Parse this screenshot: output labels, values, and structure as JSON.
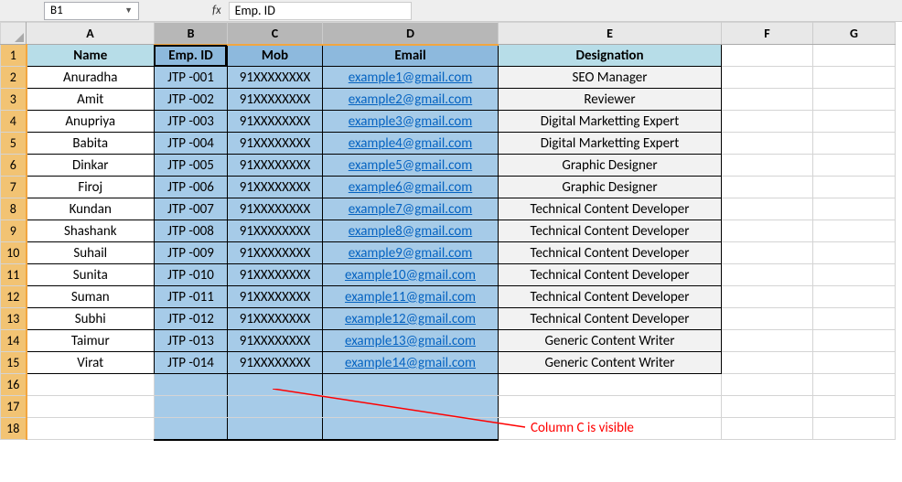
{
  "namebox": {
    "ref": "B1"
  },
  "formula_bar": {
    "fx": "fx",
    "value": "Emp. ID"
  },
  "col_letters": [
    "A",
    "B",
    "C",
    "D",
    "E",
    "F",
    "G"
  ],
  "row_numbers": [
    "1",
    "2",
    "3",
    "4",
    "5",
    "6",
    "7",
    "8",
    "9",
    "10",
    "11",
    "12",
    "13",
    "14",
    "15",
    "16",
    "17",
    "18"
  ],
  "headers": {
    "name": "Name",
    "emp": "Emp. ID",
    "mob": "Mob",
    "email": "Email",
    "desig": "Designation"
  },
  "rows": [
    {
      "name": "Anuradha",
      "emp": "JTP -001",
      "mob": "91XXXXXXXX",
      "email": "example1@gmail.com",
      "desig": "SEO Manager"
    },
    {
      "name": "Amit",
      "emp": "JTP -002",
      "mob": "91XXXXXXXX",
      "email": "example2@gmail.com",
      "desig": "Reviewer"
    },
    {
      "name": "Anupriya",
      "emp": "JTP -003",
      "mob": "91XXXXXXXX",
      "email": "example3@gmail.com",
      "desig": "Digital Marketting Expert"
    },
    {
      "name": "Babita",
      "emp": "JTP -004",
      "mob": "91XXXXXXXX",
      "email": "example4@gmail.com",
      "desig": "Digital Marketting Expert"
    },
    {
      "name": "Dinkar",
      "emp": "JTP -005",
      "mob": "91XXXXXXXX",
      "email": "example5@gmail.com",
      "desig": "Graphic Designer"
    },
    {
      "name": "Firoj",
      "emp": "JTP -006",
      "mob": "91XXXXXXXX",
      "email": "example6@gmail.com",
      "desig": "Graphic Designer"
    },
    {
      "name": "Kundan",
      "emp": "JTP -007",
      "mob": "91XXXXXXXX",
      "email": "example7@gmail.com",
      "desig": "Technical Content Developer"
    },
    {
      "name": "Shashank",
      "emp": "JTP -008",
      "mob": "91XXXXXXXX",
      "email": "example8@gmail.com",
      "desig": "Technical Content Developer"
    },
    {
      "name": "Suhail",
      "emp": "JTP -009",
      "mob": "91XXXXXXXX",
      "email": "example9@gmail.com",
      "desig": "Technical Content Developer"
    },
    {
      "name": "Sunita",
      "emp": "JTP -010",
      "mob": "91XXXXXXXX",
      "email": "example10@gmail.com",
      "desig": "Technical Content Developer"
    },
    {
      "name": "Suman",
      "emp": "JTP -011",
      "mob": "91XXXXXXXX",
      "email": "example11@gmail.com",
      "desig": "Technical Content Developer"
    },
    {
      "name": "Subhi",
      "emp": "JTP -012",
      "mob": "91XXXXXXXX",
      "email": "example12@gmail.com",
      "desig": "Technical Content Developer"
    },
    {
      "name": "Taimur",
      "emp": "JTP -013",
      "mob": "91XXXXXXXX",
      "email": "example13@gmail.com",
      "desig": "Generic Content Writer"
    },
    {
      "name": "Virat",
      "emp": "JTP -014",
      "mob": "91XXXXXXXX",
      "email": "example14@gmail.com",
      "desig": "Generic Content Writer"
    }
  ],
  "annotation": "Column C is visible"
}
